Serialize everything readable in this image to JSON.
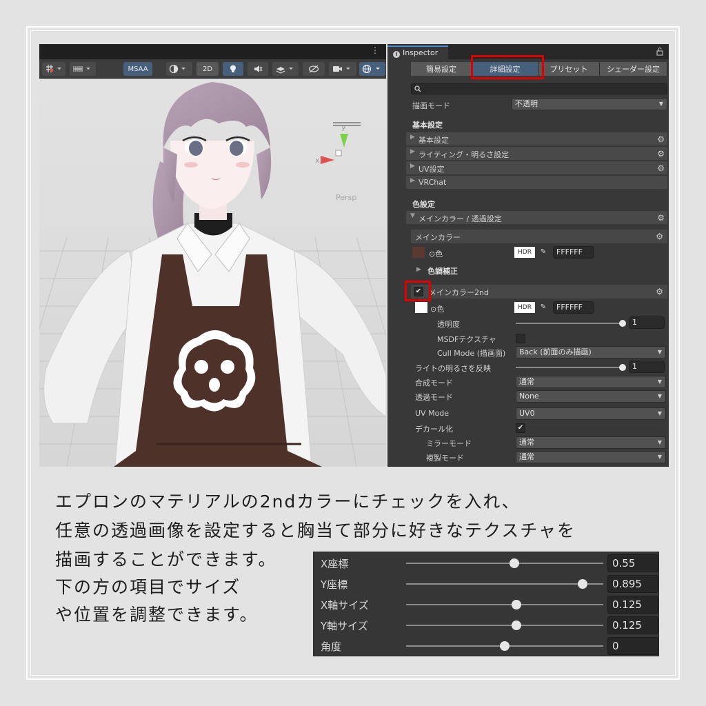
{
  "scene": {
    "toolbar": {
      "msaa": "MSAA",
      "mode_2d": "2D"
    },
    "gizmo": {
      "y_axis": "y",
      "x_axis": "x",
      "projection": "Persp"
    }
  },
  "inspector": {
    "tab_title": "Inspector",
    "tabs": [
      "簡易設定",
      "詳細設定",
      "プリセット",
      "シェーダー設定"
    ],
    "active_tab": "詳細設定",
    "render_mode": {
      "label": "描画モード",
      "value": "不透明"
    },
    "basic_section": "基本設定",
    "basic_items": [
      "基本設定",
      "ライティング・明るさ設定",
      "UV設定",
      "VRChat"
    ],
    "color_section": "色設定",
    "main_color_fold": "メインカラー / 透過設定",
    "main_color": {
      "header": "メインカラー",
      "color_label": "色",
      "hdr": "HDR",
      "hex": "FFFFFF",
      "correction": "色調補正"
    },
    "main_color_2nd": {
      "header": "メインカラー2nd",
      "enabled": true,
      "color_label": "色",
      "hdr": "HDR",
      "hex": "FFFFFF",
      "opacity_label": "透明度",
      "opacity_value": "1",
      "msdf_label": "MSDFテクスチャ",
      "cull_label": "Cull Mode (描画面)",
      "cull_value": "Back (前面のみ描画)",
      "light_label": "ライトの明るさを反映",
      "light_value": "1",
      "blend_label": "合成モード",
      "blend_value": "通常",
      "alpha_label": "透過モード",
      "alpha_value": "None",
      "uv_label": "UV Mode",
      "uv_value": "UV0",
      "decal_label": "デカール化",
      "decal_enabled": true,
      "mirror_label": "ミラーモード",
      "mirror_value": "通常",
      "copy_label": "複製モード",
      "copy_value": "通常"
    }
  },
  "caption": {
    "line1": "エプロンのマテリアルの2ndカラーにチェックを入れ、",
    "line2": "任意の透過画像を設定すると胸当て部分に好きなテクスチャを",
    "line3": "描画することができます。",
    "line4": "下の方の項目でサイズ",
    "line5": "や位置を調整できます。"
  },
  "decal_panel": [
    {
      "label": "X座標",
      "value": "0.55",
      "slider": 0.55
    },
    {
      "label": "Y座標",
      "value": "0.895",
      "slider": 0.895
    },
    {
      "label": "X軸サイズ",
      "value": "0.125",
      "slider": 0.56
    },
    {
      "label": "Y軸サイズ",
      "value": "0.125",
      "slider": 0.56
    },
    {
      "label": "角度",
      "value": "0",
      "slider": 0.5
    }
  ],
  "colors": {
    "highlight": "#e00000",
    "active_tab": "#46607c",
    "inspector_bg": "#383838",
    "apron": "#4e3128"
  }
}
